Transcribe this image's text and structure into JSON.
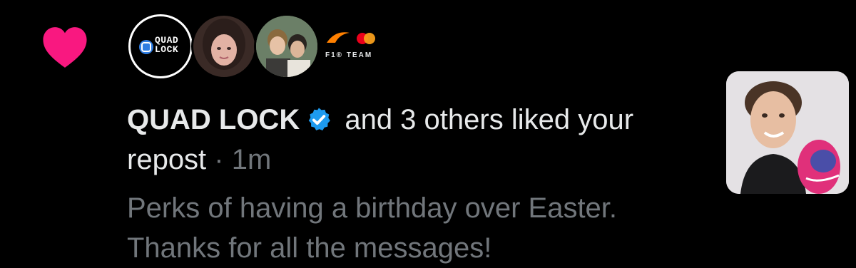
{
  "notification": {
    "icon": "heart-icon",
    "heart_color": "#f91880",
    "avatars": [
      {
        "name": "quad-lock-avatar",
        "logo_text_line1": "QUAD",
        "logo_text_line2": "LOCK"
      },
      {
        "name": "user-avatar-1"
      },
      {
        "name": "user-avatar-2"
      },
      {
        "name": "f1-team-avatar",
        "label": "F1® TEAM"
      }
    ],
    "actor_name": "QUAD LOCK",
    "verified_icon": "verified-badge-icon",
    "verified_color": "#1d9bf0",
    "action_text": " and 3 others liked your",
    "object_text": "repost",
    "separator": " · ",
    "time": "1m",
    "post_line1": "Perks of having a birthday over Easter.",
    "post_line2": "Thanks for all the messages!"
  },
  "colors": {
    "background": "#000000",
    "primary_text": "#e7e9ea",
    "secondary_text": "#71767b"
  }
}
